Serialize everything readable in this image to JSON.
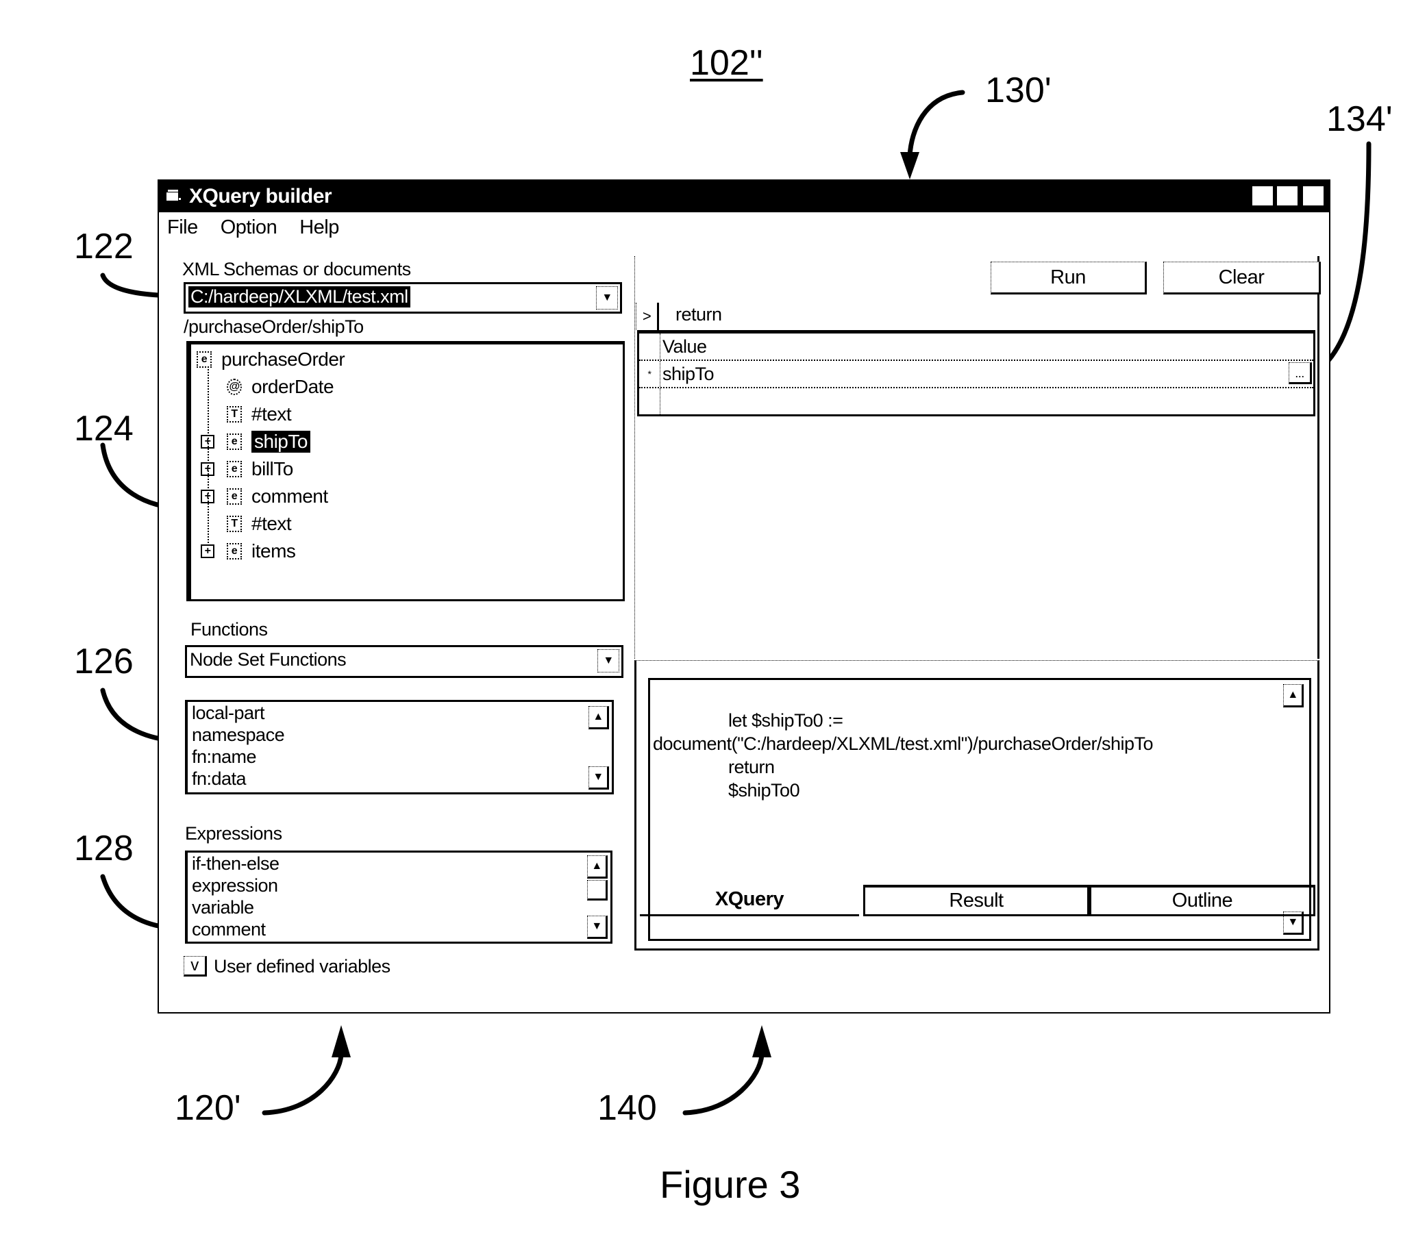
{
  "figure": {
    "reference": "102''",
    "caption": "Figure 3",
    "callouts": {
      "c122": "122",
      "c124": "124",
      "c126": "126",
      "c128": "128",
      "c130": "130'",
      "c134": "134'",
      "c120": "120'",
      "c140": "140"
    }
  },
  "window": {
    "title": "XQuery builder",
    "controls": {
      "minimize": "_",
      "maximize": "□",
      "close": "✕"
    }
  },
  "menu": [
    "File",
    "Option",
    "Help"
  ],
  "left": {
    "schemas_label": "XML Schemas or documents",
    "schemas_value": "C:/hardeep/XLXML/test.xml",
    "path_label": "/purchaseOrder/shipTo",
    "tree": [
      {
        "label": "purchaseOrder",
        "icon": "e"
      },
      {
        "label": "orderDate",
        "icon": "@"
      },
      {
        "label": "#text",
        "icon": "T"
      },
      {
        "label": "shipTo",
        "icon": "e",
        "selected": true
      },
      {
        "label": "billTo",
        "icon": "e"
      },
      {
        "label": "comment",
        "icon": "e"
      },
      {
        "label": "#text",
        "icon": "T"
      },
      {
        "label": "items",
        "icon": "e"
      }
    ],
    "functions_label": "Functions",
    "functions_value": "Node Set Functions",
    "functions_list": [
      "local-part",
      "namespace",
      "fn:name",
      "fn:data"
    ],
    "expressions_label": "Expressions",
    "expressions_list": [
      "if-then-else",
      "expression",
      "variable",
      "comment"
    ],
    "user_vars_toggle": "v",
    "user_vars_label": "User defined variables"
  },
  "right": {
    "run_label": "Run",
    "clear_label": "Clear",
    "clause_toggle": ">",
    "clause_label": "return",
    "grid_header": "Value",
    "grid_rows": [
      {
        "indicator": "*",
        "value": "shipTo",
        "ellipsis": "..."
      }
    ],
    "code_lines": [
      "let $shipTo0 :=",
      "document(\"C:/hardeep/XLXML/test.xml\")/purchaseOrder/shipTo",
      "return",
      "$shipTo0"
    ],
    "tabs": [
      "XQuery",
      "Result",
      "Outline"
    ],
    "active_tab": "XQuery"
  }
}
